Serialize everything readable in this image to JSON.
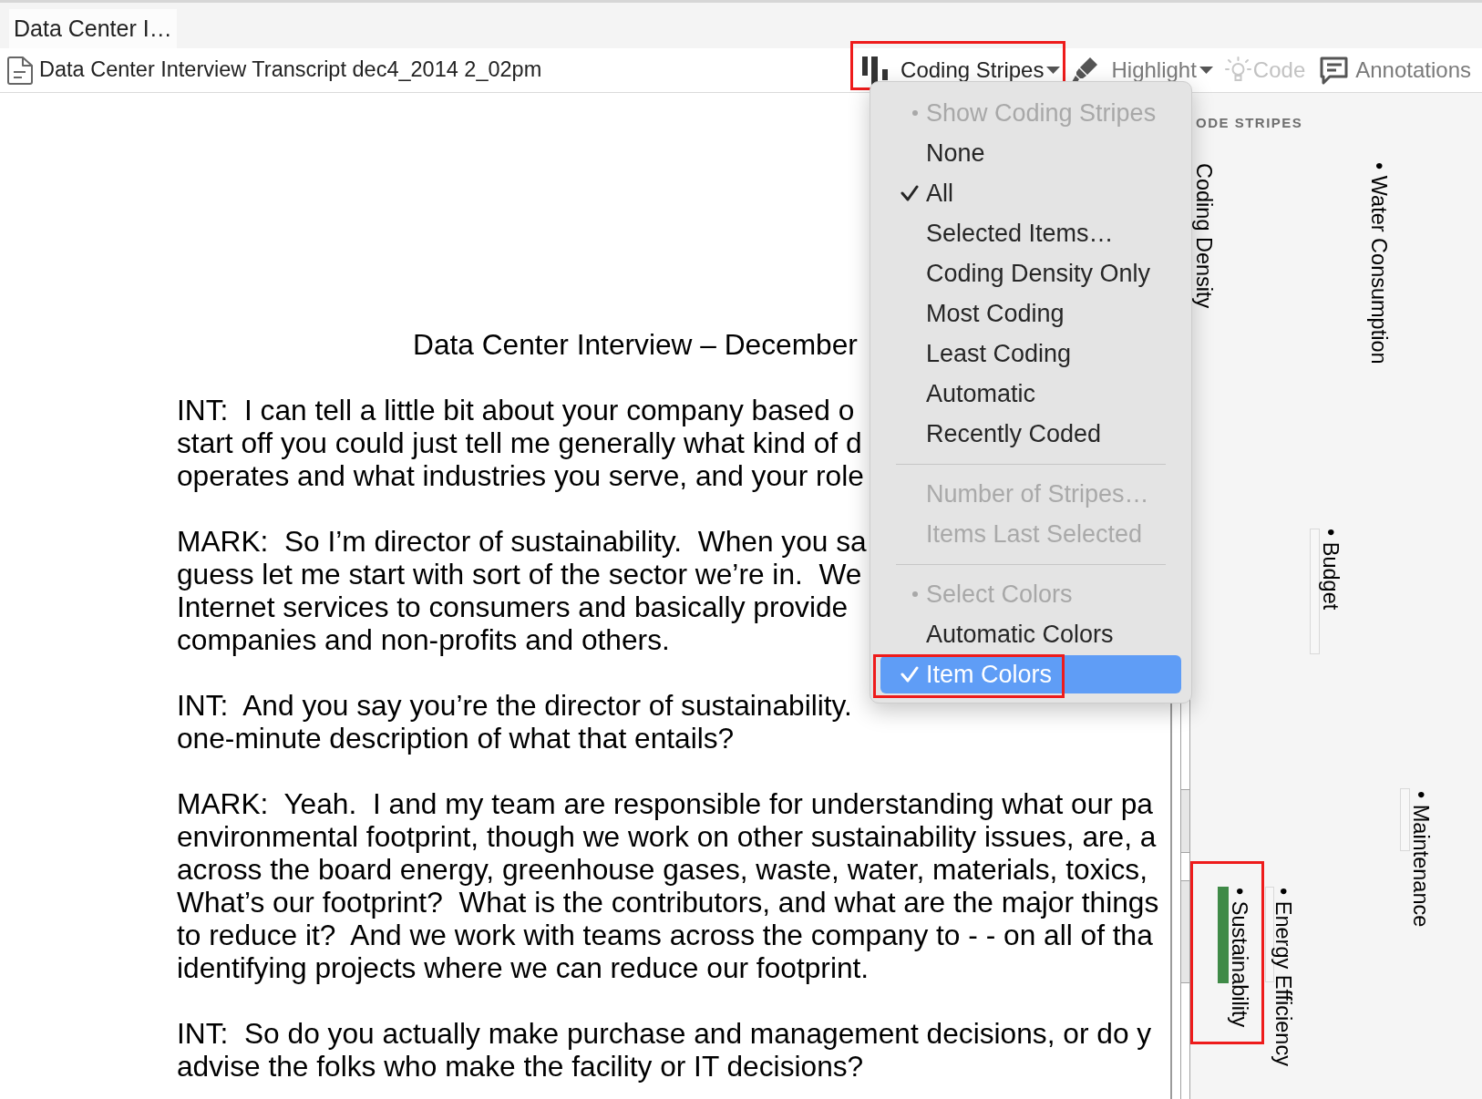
{
  "tabs": [
    {
      "label": "Data Center I…",
      "selected": true
    }
  ],
  "toolbar": {
    "document_title": "Data Center Interview Transcript dec4_2014 2_02pm",
    "buttons": [
      {
        "label": "Coding Stripes",
        "kind": "dropdown",
        "expanded": true,
        "disabled": false,
        "callout": true
      },
      {
        "label": "Highlight",
        "kind": "dropdown",
        "expanded": false,
        "disabled": false,
        "callout": false
      },
      {
        "label": "Code",
        "kind": "plain",
        "expanded": false,
        "disabled": true,
        "callout": false
      },
      {
        "label": "Annotations",
        "kind": "plain",
        "expanded": false,
        "disabled": false,
        "callout": false
      }
    ]
  },
  "stripes_menu": {
    "items": [
      {
        "kind": "header",
        "label": "Show Coding Stripes"
      },
      {
        "kind": "option",
        "label": "None",
        "checked": false,
        "disabled": false,
        "selected": false,
        "callout": false
      },
      {
        "kind": "option",
        "label": "All",
        "checked": true,
        "disabled": false,
        "selected": false,
        "callout": false
      },
      {
        "kind": "option",
        "label": "Selected Items…",
        "checked": false,
        "disabled": false,
        "selected": false,
        "callout": false
      },
      {
        "kind": "option",
        "label": "Coding Density Only",
        "checked": false,
        "disabled": false,
        "selected": false,
        "callout": false
      },
      {
        "kind": "option",
        "label": "Most Coding",
        "checked": false,
        "disabled": false,
        "selected": false,
        "callout": false
      },
      {
        "kind": "option",
        "label": "Least Coding",
        "checked": false,
        "disabled": false,
        "selected": false,
        "callout": false
      },
      {
        "kind": "option",
        "label": "Automatic",
        "checked": false,
        "disabled": false,
        "selected": false,
        "callout": false
      },
      {
        "kind": "option",
        "label": "Recently Coded",
        "checked": false,
        "disabled": false,
        "selected": false,
        "callout": false
      },
      {
        "kind": "separator"
      },
      {
        "kind": "option",
        "label": "Number of Stripes…",
        "checked": false,
        "disabled": true,
        "selected": false,
        "callout": false
      },
      {
        "kind": "option",
        "label": "Items Last Selected",
        "checked": false,
        "disabled": true,
        "selected": false,
        "callout": false
      },
      {
        "kind": "separator"
      },
      {
        "kind": "header",
        "label": "Select Colors"
      },
      {
        "kind": "option",
        "label": "Automatic Colors",
        "checked": false,
        "disabled": false,
        "selected": false,
        "callout": false
      },
      {
        "kind": "option",
        "label": "Item Colors",
        "checked": true,
        "disabled": false,
        "selected": true,
        "callout": true
      }
    ]
  },
  "document": {
    "heading": "Data Center Interview – December",
    "paragraphs": [
      {
        "lines": [
          "INT:  I can tell a little bit about your company based o",
          "start off you could just tell me generally what kind of d",
          "operates and what industries you serve, and your role"
        ]
      },
      {
        "lines": [
          "MARK:  So I’m director of sustainability.  When you sa",
          "guess let me start with sort of the sector we’re in.  We",
          "Internet services to consumers and basically provide",
          "companies and non-profits and others."
        ]
      },
      {
        "lines": [
          "INT:  And you say you’re the director of sustainability.",
          "one-minute description of what that entails?"
        ]
      },
      {
        "lines": [
          "MARK:  Yeah.  I and my team are responsible for understanding what our pa",
          "environmental footprint, though we work on other sustainability issues, are, a",
          "across the board energy, greenhouse gases, waste, water, materials, toxics,",
          "What’s our footprint?  What is the contributors, and what are the major things",
          "to reduce it?  And we work with teams across the company to - - on all of tha",
          "identifying projects where we can reduce our footprint."
        ]
      },
      {
        "lines": [
          "INT:  So do you actually make purchase and management decisions, or do y",
          "advise the folks who make the facility or IT decisions?"
        ]
      }
    ]
  },
  "code_stripes_panel": {
    "heading": "ODE STRIPES",
    "density_label": "Coding Density",
    "stripes": [
      {
        "label": "• Sustainability",
        "color": "#3f8a47",
        "callout": true
      },
      {
        "label": "• Energy Efficiency",
        "callout": false
      },
      {
        "label": "• Budget",
        "callout": false
      },
      {
        "label": "• Water Consumption",
        "callout": false
      },
      {
        "label": "• Maintenance",
        "callout": false
      }
    ]
  }
}
